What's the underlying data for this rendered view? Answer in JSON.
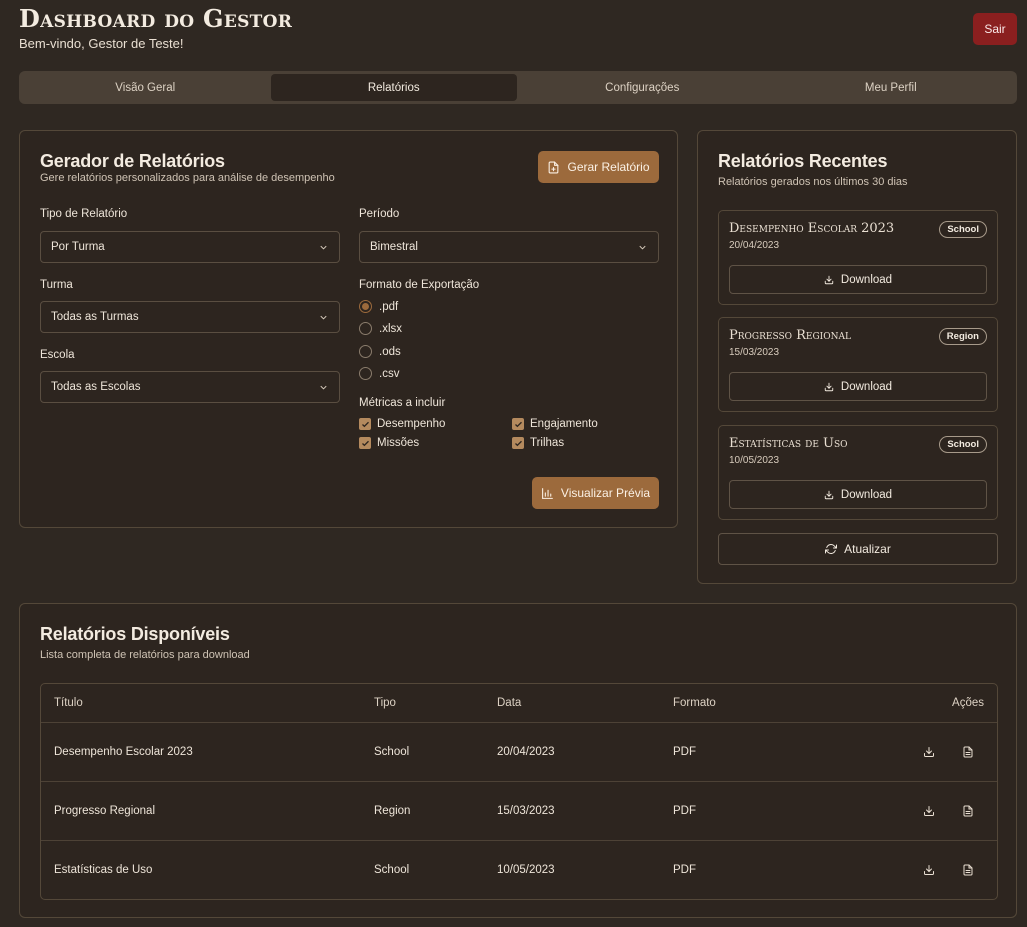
{
  "header": {
    "title": "Dashboard do Gestor",
    "welcome": "Bem-vindo, Gestor de Teste!",
    "logout": "Sair"
  },
  "tabs": [
    {
      "label": "Visão Geral",
      "active": false
    },
    {
      "label": "Relatórios",
      "active": true
    },
    {
      "label": "Configurações",
      "active": false
    },
    {
      "label": "Meu Perfil",
      "active": false
    }
  ],
  "generator": {
    "title": "Gerador de Relatórios",
    "subtitle": "Gere relatórios personalizados para análise de desempenho",
    "generate_button": "Gerar Relatório",
    "report_type": {
      "label": "Tipo de Relatório",
      "value": "Por Turma"
    },
    "class": {
      "label": "Turma",
      "value": "Todas as Turmas"
    },
    "school": {
      "label": "Escola",
      "value": "Todas as Escolas"
    },
    "period": {
      "label": "Período",
      "value": "Bimestral"
    },
    "export_format": {
      "label": "Formato de Exportação",
      "options": [
        ".pdf",
        ".xlsx",
        ".ods",
        ".csv"
      ],
      "selected": ".pdf"
    },
    "metrics": {
      "label": "Métricas a incluir",
      "items": [
        {
          "label": "Desempenho",
          "checked": true
        },
        {
          "label": "Engajamento",
          "checked": true
        },
        {
          "label": "Missões",
          "checked": true
        },
        {
          "label": "Trilhas",
          "checked": true
        }
      ]
    },
    "preview_button": "Visualizar Prévia"
  },
  "recent": {
    "title": "Relatórios Recentes",
    "subtitle": "Relatórios gerados nos últimos 30 dias",
    "items": [
      {
        "title": "Desempenho Escolar 2023",
        "date": "20/04/2023",
        "badge": "School",
        "button": "Download"
      },
      {
        "title": "Progresso Regional",
        "date": "15/03/2023",
        "badge": "Region",
        "button": "Download"
      },
      {
        "title": "Estatísticas de Uso",
        "date": "10/05/2023",
        "badge": "School",
        "button": "Download"
      }
    ],
    "refresh_button": "Atualizar"
  },
  "available": {
    "title": "Relatórios Disponíveis",
    "subtitle": "Lista completa de relatórios para download",
    "columns": [
      "Título",
      "Tipo",
      "Data",
      "Formato",
      "Ações"
    ],
    "rows": [
      {
        "title": "Desempenho Escolar 2023",
        "type": "School",
        "date": "20/04/2023",
        "format": "PDF"
      },
      {
        "title": "Progresso Regional",
        "type": "Region",
        "date": "15/03/2023",
        "format": "PDF"
      },
      {
        "title": "Estatísticas de Uso",
        "type": "School",
        "date": "10/05/2023",
        "format": "PDF"
      }
    ]
  },
  "colors": {
    "background": "#2f2822",
    "accent": "#9c6a3c",
    "danger": "#8a1f1f",
    "border": "#544839"
  },
  "icons": [
    "file-plus-icon",
    "chevron-down-icon",
    "bar-chart-icon",
    "download-icon",
    "refresh-icon",
    "file-text-icon",
    "check-icon"
  ]
}
